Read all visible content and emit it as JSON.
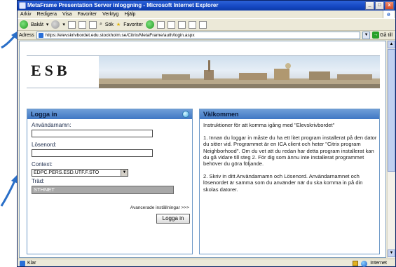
{
  "window": {
    "title": "MetaFrame Presentation Server inloggning - Microsoft Internet Explorer",
    "controls": [
      "_",
      "□",
      "x"
    ]
  },
  "menu": [
    "Arkiv",
    "Redigera",
    "Visa",
    "Favoriter",
    "Verktyg",
    "Hjälp"
  ],
  "toolbar": {
    "back_label": "Bakåt",
    "search_label": "Sök",
    "favorites_label": "Favoriter"
  },
  "address": {
    "label": "Adress",
    "url": "https://elevskrivbordet.edu.stockholm.se/Citrix/MetaFrame/auth/login.aspx",
    "go_label": "Gå till"
  },
  "header": {
    "logo_text": "ESB"
  },
  "login": {
    "heading": "Logga in",
    "username_label": "Användarnamn:",
    "password_label": "Lösenord:",
    "context_label": "Context:",
    "context_value": "EDPC.PERS.ESD.UTF.F.STO",
    "tree_label": "Träd:",
    "tree_value": "STHNET",
    "advanced_link": "Avancerade inställningar >>>",
    "submit_label": "Logga in"
  },
  "welcome": {
    "heading": "Välkommen",
    "paragraphs": [
      "Instruktioner för att komma igång med \"Elevskrivbordet\"",
      "1. Innan du loggar in måste du ha ett litet program installerat på den dator du sitter vid. Programmet är en ICA client och heter \"Citrix program Neighborhood\". Om du vet att du redan har detta program installerat kan du gå vidare till steg 2. För dig som ännu inte installerat programmet behöver du göra följande.",
      "2. Skriv in ditt Användarnamn och Lösenord. Användarnamnet och lösenordet är samma som du använder när du ska komma in på din skolas datorer."
    ]
  },
  "status": {
    "text": "Klar",
    "zone": "Internet"
  },
  "colors": {
    "titlebar": "#1447c2",
    "panel_head": "#3f77c4",
    "callout_arrow": "#2a6fc8"
  }
}
